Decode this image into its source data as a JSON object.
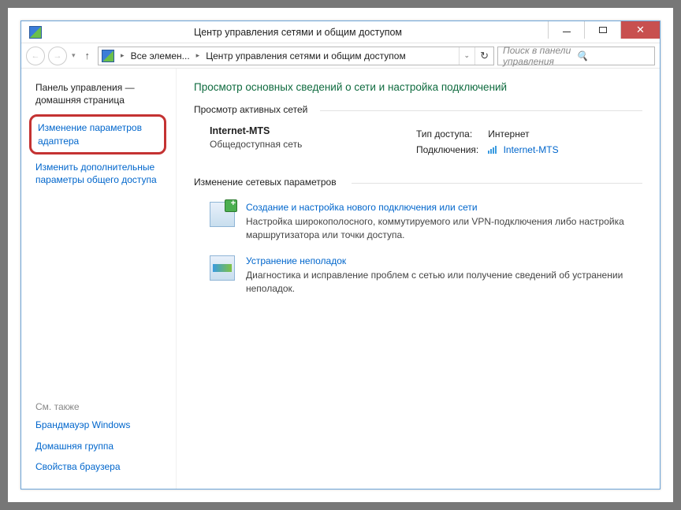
{
  "window": {
    "title": "Центр управления сетями и общим доступом"
  },
  "breadcrumb": {
    "seg1": "Все элемен...",
    "seg2": "Центр управления сетями и общим доступом"
  },
  "search": {
    "placeholder": "Поиск в панели управления"
  },
  "sidebar": {
    "home1": "Панель управления —",
    "home2": "домашняя страница",
    "adapter": "Изменение параметров адаптера",
    "advanced1": "Изменить дополнительные",
    "advanced2": "параметры общего доступа",
    "see_also": "См. также",
    "firewall": "Брандмауэр Windows",
    "homegroup": "Домашняя группа",
    "browser": "Свойства браузера"
  },
  "main": {
    "heading": "Просмотр основных сведений о сети и настройка подключений",
    "active_label": "Просмотр активных сетей",
    "network": {
      "name": "Internet-MTS",
      "type": "Общедоступная сеть",
      "access_label": "Тип доступа:",
      "access_value": "Интернет",
      "conn_label": "Подключения:",
      "conn_value": "Internet-MTS"
    },
    "change_label": "Изменение сетевых параметров",
    "items": {
      "new_conn_title": "Создание и настройка нового подключения или сети",
      "new_conn_desc": "Настройка широкополосного, коммутируемого или VPN-подключения либо настройка маршрутизатора или точки доступа.",
      "trouble_title": "Устранение неполадок",
      "trouble_desc": "Диагностика и исправление проблем с сетью или получение сведений об устранении неполадок."
    }
  }
}
